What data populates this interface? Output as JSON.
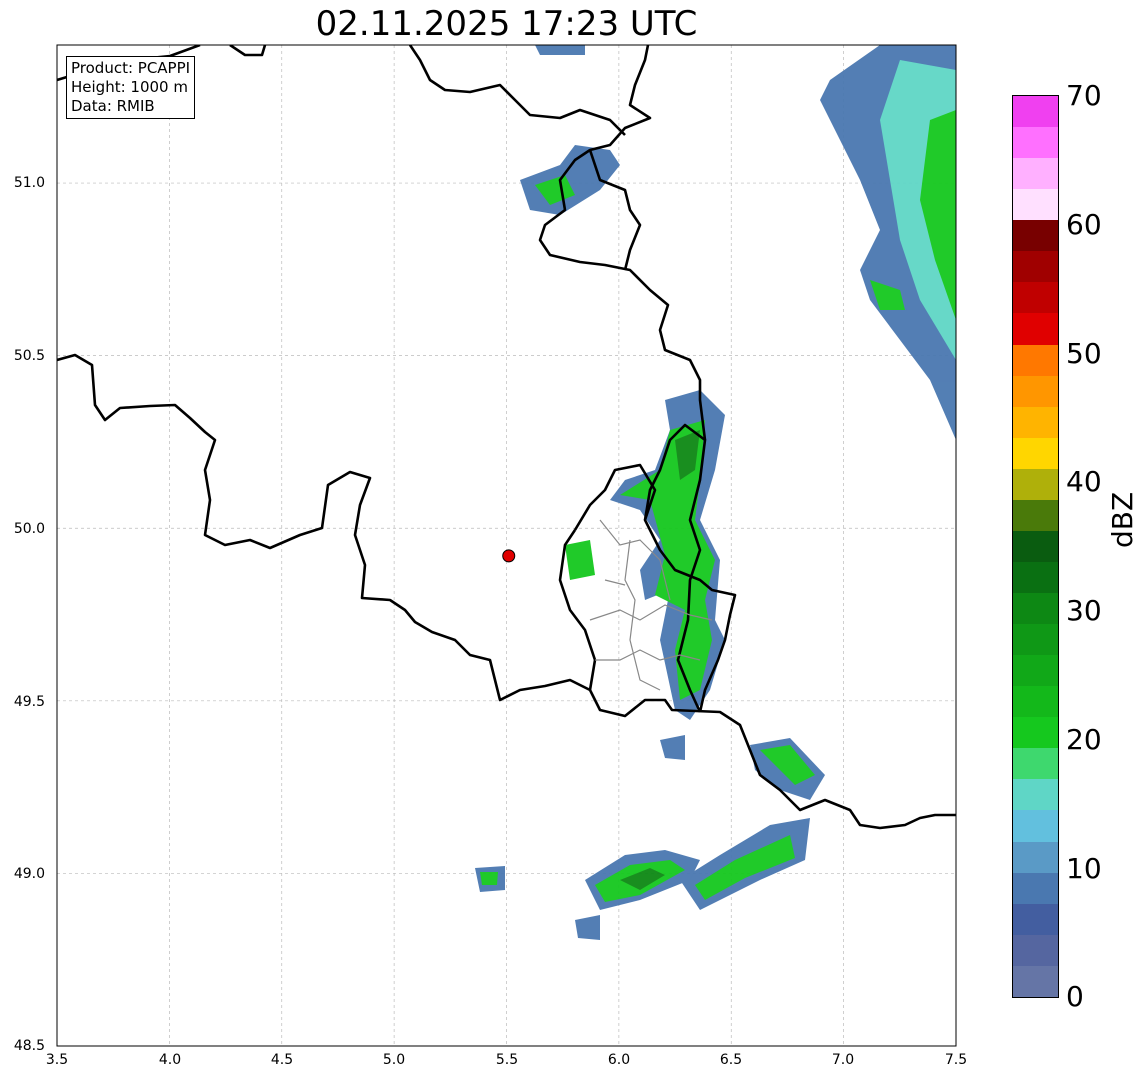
{
  "title": "02.11.2025 17:23 UTC",
  "info": {
    "product": "Product: PCAPPI",
    "height": "Height: 1000 m",
    "data": "Data: RMIB"
  },
  "axes": {
    "y_ticks": [
      "51.0",
      "50.5",
      "50.0",
      "49.5",
      "49.0",
      "48.5"
    ],
    "x_ticks": [
      "3.5",
      "4.0",
      "4.5",
      "5.0",
      "5.5",
      "6.0",
      "6.5",
      "7.0",
      "7.5"
    ],
    "lon_range": [
      3.5,
      7.5
    ],
    "lat_range": [
      48.5,
      51.4
    ],
    "grid": true
  },
  "radar_site": {
    "lon": 5.51,
    "lat": 49.92,
    "color": "#e00000"
  },
  "colorbar": {
    "label": "dBZ",
    "ticks": [
      "70",
      "60",
      "50",
      "40",
      "30",
      "20",
      "10",
      "0"
    ],
    "range": [
      0,
      70
    ],
    "colors": [
      "#6575a6",
      "#5566a0",
      "#435ea0",
      "#4a78b0",
      "#5a9ac6",
      "#62c0de",
      "#5fd6c6",
      "#3ed86e",
      "#15c81e",
      "#13b81a",
      "#11a818",
      "#0f9816",
      "#0d8814",
      "#0a7012",
      "#0a5c10",
      "#4a7a0a",
      "#afb00a",
      "#ffd600",
      "#ffb400",
      "#ff9600",
      "#ff7800",
      "#e00000",
      "#c00000",
      "#a00000",
      "#780000",
      "#ffe0ff",
      "#ffb0ff",
      "#ff70ff",
      "#f040f0"
    ]
  }
}
